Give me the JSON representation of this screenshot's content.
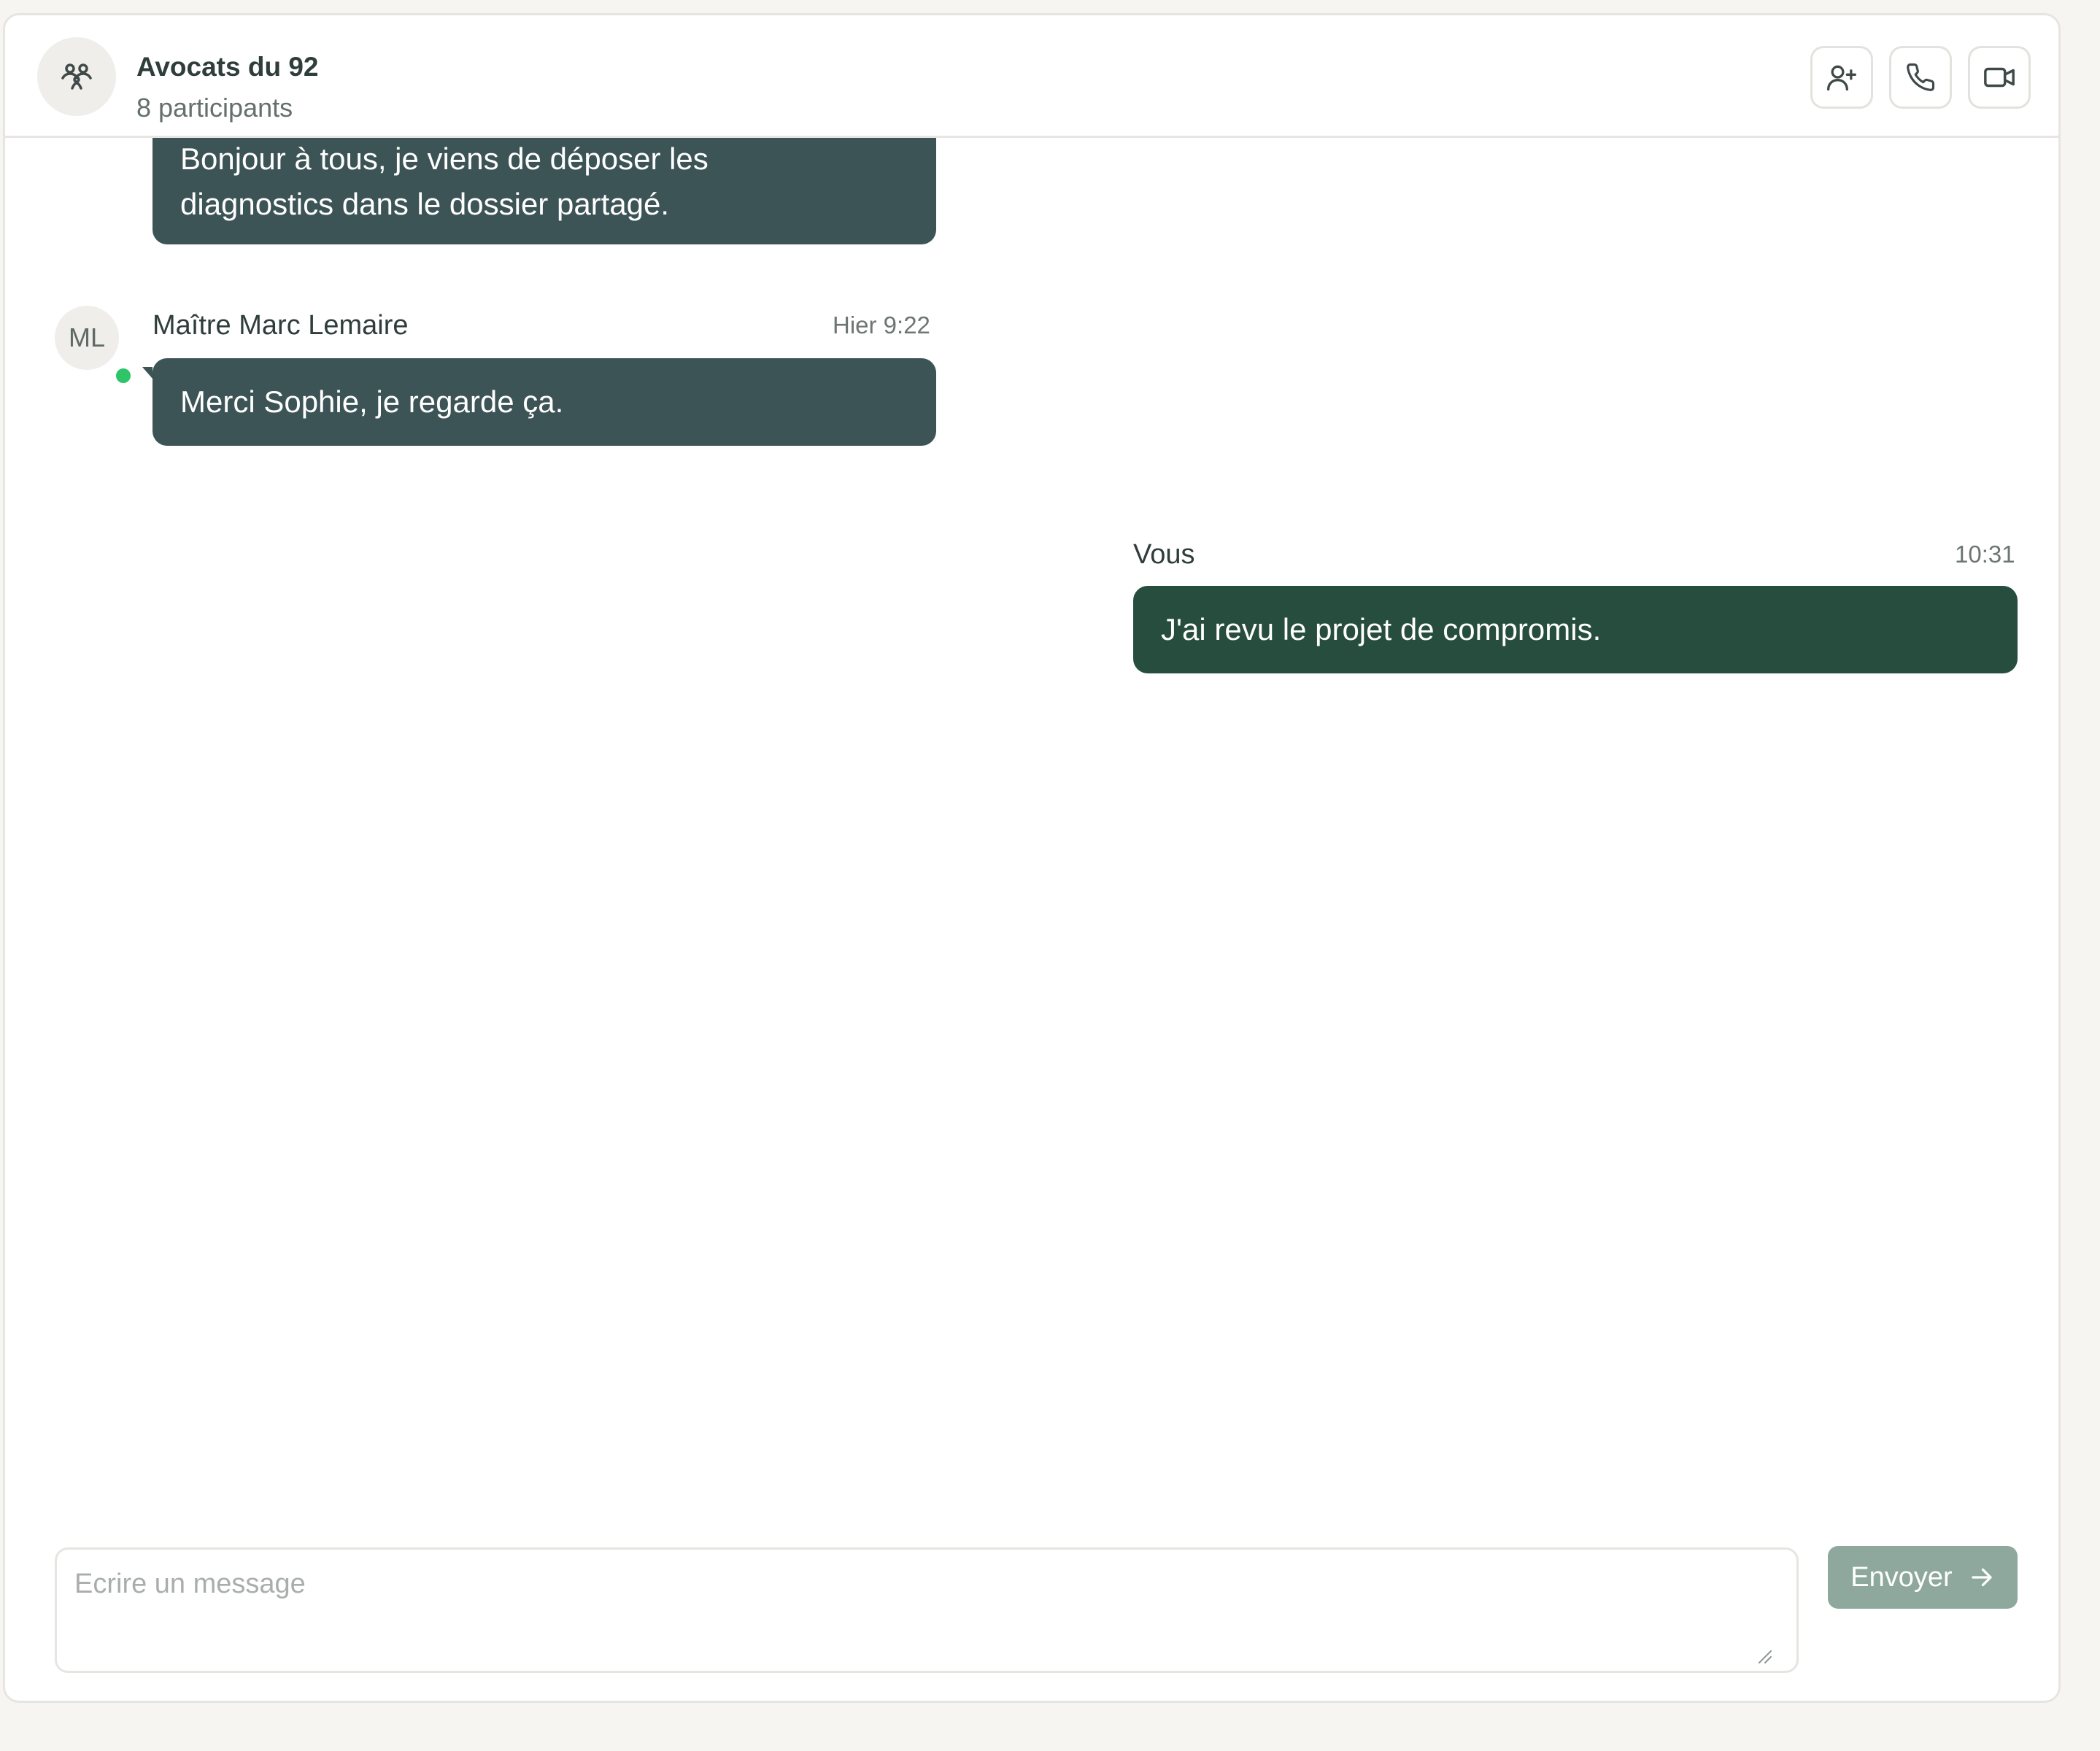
{
  "header": {
    "title": "Avocats du 92",
    "subtitle": "8 participants",
    "actions": [
      {
        "name": "add-participant",
        "icon": "user-plus-icon"
      },
      {
        "name": "call",
        "icon": "phone-icon"
      },
      {
        "name": "video",
        "icon": "video-icon"
      }
    ]
  },
  "messages": [
    {
      "sender": "",
      "time": "",
      "lines": [
        "Bonjour à tous, je viens de déposer les",
        "diagnostics dans le dossier partagé."
      ],
      "side": "left"
    },
    {
      "sender": "Maître Marc Lemaire",
      "initials": "ML",
      "online": true,
      "time": "Hier 9:22",
      "text": "Merci Sophie, je regarde ça.",
      "side": "left"
    },
    {
      "sender": "Vous",
      "time": "10:31",
      "text": "J'ai revu le projet de compromis.",
      "side": "right"
    }
  ],
  "composer": {
    "placeholder": "Ecrire un message",
    "value": "",
    "send_label": "Envoyer"
  },
  "colors": {
    "bubble_other": "#3d5457",
    "bubble_self": "#264d3d",
    "send_button": "#8ea89d",
    "online": "#2fc468"
  }
}
